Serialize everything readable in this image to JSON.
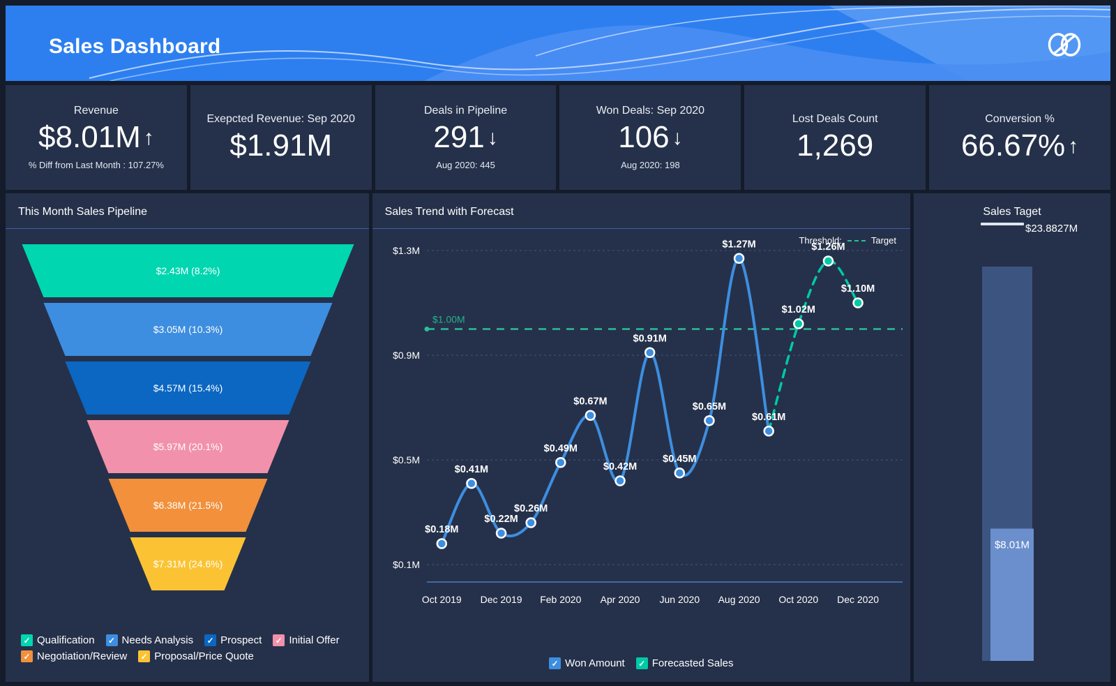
{
  "header": {
    "title": "Sales Dashboard",
    "logo_icon": "zoho-loops-logo-icon",
    "brand_color": "#2d7ff0"
  },
  "kpis": [
    {
      "label": "Revenue",
      "value": "$8.01M",
      "arrow": "↑",
      "sub": "% Diff from Last Month : 107.27%"
    },
    {
      "label": "Exepcted Revenue: Sep 2020",
      "value": "$1.91M",
      "arrow": "",
      "sub": ""
    },
    {
      "label": "Deals in Pipeline",
      "value": "291",
      "arrow": "↓",
      "sub": "Aug 2020: 445"
    },
    {
      "label": "Won Deals: Sep 2020",
      "value": "106",
      "arrow": "↓",
      "sub": "Aug 2020: 198"
    },
    {
      "label": "Lost Deals Count",
      "value": "1,269",
      "arrow": "",
      "sub": ""
    },
    {
      "label": "Conversion %",
      "value": "66.67%",
      "arrow": "↑",
      "sub": ""
    }
  ],
  "funnel": {
    "title": "This Month Sales Pipeline",
    "legend": [
      {
        "label": "Qualification",
        "color": "#00d6b0"
      },
      {
        "label": "Needs Analysis",
        "color": "#3d8ee0"
      },
      {
        "label": "Prospect",
        "color": "#0b67c2"
      },
      {
        "label": "Initial Offer",
        "color": "#f291ab"
      },
      {
        "label": "Negotiation/Review",
        "color": "#f2903c"
      },
      {
        "label": "Proposal/Price Quote",
        "color": "#fbc333"
      }
    ]
  },
  "trend": {
    "title": "Sales Trend with Forecast",
    "threshold_label": "Threshold:",
    "threshold_series": "Target",
    "threshold_value_label": "$1.00M",
    "legend": [
      {
        "label": "Won Amount",
        "color": "#3d8ee0"
      },
      {
        "label": "Forecasted Sales",
        "color": "#00c9a7"
      }
    ]
  },
  "target": {
    "title": "Sales Taget",
    "target_amount": "$23.8827M",
    "achieved_label": "$8.01M",
    "track_color": "#3c5480",
    "fill_color": "#6b8fcd"
  },
  "chart_data": [
    {
      "type": "funnel",
      "title": "This Month Sales Pipeline",
      "stages": [
        {
          "label": "Qualification",
          "value_label": "$2.43M (8.2%)",
          "amount": 2.43,
          "percent": 8.2,
          "color": "#00d6b0"
        },
        {
          "label": "Needs Analysis",
          "value_label": "$3.05M (10.3%)",
          "amount": 3.05,
          "percent": 10.3,
          "color": "#3d8ee0"
        },
        {
          "label": "Prospect",
          "value_label": "$4.57M (15.4%)",
          "amount": 4.57,
          "percent": 15.4,
          "color": "#0b67c2"
        },
        {
          "label": "Initial Offer",
          "value_label": "$5.97M (20.1%)",
          "amount": 5.97,
          "percent": 20.1,
          "color": "#f291ab"
        },
        {
          "label": "Negotiation/Review",
          "value_label": "$6.38M (21.5%)",
          "amount": 6.38,
          "percent": 21.5,
          "color": "#f2903c"
        },
        {
          "label": "Proposal/Price Quote",
          "value_label": "$7.31M (24.6%)",
          "amount": 7.31,
          "percent": 24.6,
          "color": "#fbc333"
        }
      ]
    },
    {
      "type": "line",
      "title": "Sales Trend with Forecast",
      "xlabel": "",
      "ylabel": "",
      "x_tick_labels": [
        "Oct 2019",
        "Dec 2019",
        "Feb 2020",
        "Apr 2020",
        "Jun 2020",
        "Aug 2020",
        "Oct 2020",
        "Dec 2020"
      ],
      "y_tick_labels": [
        "$1.3M",
        "$0.9M",
        "$0.5M",
        "$0.1M"
      ],
      "ylim": [
        0.1,
        1.3
      ],
      "grid": true,
      "legend_position": "bottom",
      "threshold": {
        "label": "Target",
        "value": 1.0,
        "value_label": "$1.00M",
        "color": "#2bbf96",
        "style": "dashed"
      },
      "series": [
        {
          "name": "Won Amount",
          "color": "#3d8ee0",
          "style": "solid",
          "points": [
            {
              "x": "Oct 2019",
              "y": 0.18,
              "label": "$0.18M"
            },
            {
              "x": "Nov 2019",
              "y": 0.41,
              "label": "$0.41M"
            },
            {
              "x": "Dec 2019",
              "y": 0.22,
              "label": "$0.22M"
            },
            {
              "x": "Jan 2020",
              "y": 0.26,
              "label": "$0.26M"
            },
            {
              "x": "Feb 2020",
              "y": 0.49,
              "label": "$0.49M"
            },
            {
              "x": "Mar 2020",
              "y": 0.67,
              "label": "$0.67M"
            },
            {
              "x": "Apr 2020",
              "y": 0.42,
              "label": "$0.42M"
            },
            {
              "x": "May 2020",
              "y": 0.91,
              "label": "$0.91M"
            },
            {
              "x": "Jun 2020",
              "y": 0.45,
              "label": "$0.45M"
            },
            {
              "x": "Jul 2020",
              "y": 0.65,
              "label": "$0.65M"
            },
            {
              "x": "Aug 2020",
              "y": 1.27,
              "label": "$1.27M"
            },
            {
              "x": "Sep 2020",
              "y": 0.61,
              "label": "$0.61M"
            }
          ]
        },
        {
          "name": "Forecasted Sales",
          "color": "#00c9a7",
          "style": "dashed",
          "points": [
            {
              "x": "Oct 2020",
              "y": 1.02,
              "label": "$1.02M"
            },
            {
              "x": "Nov 2020",
              "y": 1.26,
              "label": "$1.26M"
            },
            {
              "x": "Dec 2020",
              "y": 1.1,
              "label": "$1.10M"
            }
          ]
        }
      ]
    },
    {
      "type": "bar",
      "orientation": "vertical",
      "title": "Sales Taget",
      "categories": [
        "Sales Target"
      ],
      "values": [
        8.01
      ],
      "target": 23.8827,
      "target_label": "$23.8827M",
      "value_labels": [
        "$8.01M"
      ],
      "ylim": [
        0,
        23.8827
      ]
    }
  ]
}
